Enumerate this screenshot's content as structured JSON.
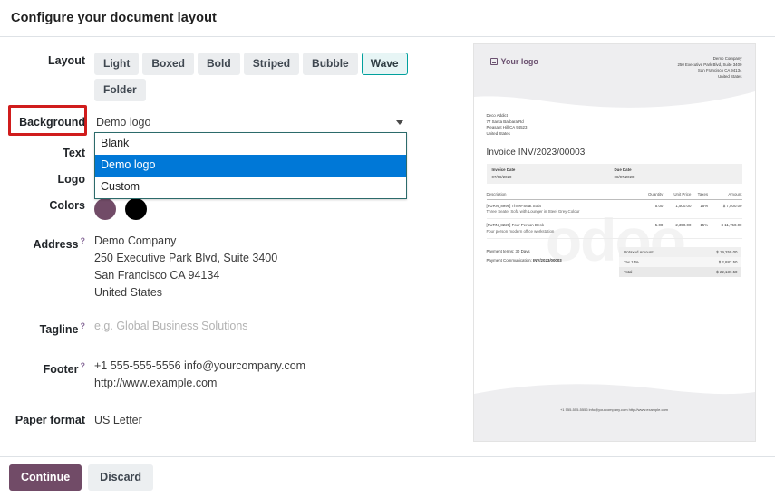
{
  "dialog": {
    "title": "Configure your document layout",
    "continue_label": "Continue",
    "discard_label": "Discard"
  },
  "form": {
    "layout": {
      "label": "Layout",
      "options": [
        "Light",
        "Boxed",
        "Bold",
        "Striped",
        "Bubble",
        "Wave",
        "Folder"
      ],
      "selected": "Wave"
    },
    "background": {
      "label": "Background",
      "value": "Demo logo",
      "open": true,
      "options": [
        "Blank",
        "Demo logo",
        "Custom"
      ],
      "selected": "Demo logo"
    },
    "text": {
      "label": "Text",
      "value": ""
    },
    "logo": {
      "label": "Logo",
      "value": ""
    },
    "colors": {
      "label": "Colors",
      "primary": "#714B67",
      "secondary": "#000000"
    },
    "address": {
      "label": "Address",
      "help": "?",
      "lines": [
        "Demo Company",
        "250 Executive Park Blvd, Suite 3400",
        "San Francisco CA 94134",
        "United States"
      ]
    },
    "tagline": {
      "label": "Tagline",
      "help": "?",
      "placeholder": "e.g. Global Business Solutions",
      "value": ""
    },
    "footer": {
      "label": "Footer",
      "help": "?",
      "lines": [
        "+1 555-555-5556 info@yourcompany.com",
        "http://www.example.com"
      ]
    },
    "paper_format": {
      "label": "Paper format",
      "value": "US Letter"
    }
  },
  "preview": {
    "logo_text": "Your logo",
    "logo_icon": "image-icon",
    "watermark": "odoo",
    "company_address": [
      "Demo Company",
      "250 Executive Park Blvd, Suite 3400",
      "San Francisco CA 94134",
      "United States"
    ],
    "customer_address": [
      "Deco Addict",
      "77 Santa Barbara Rd",
      "Pleasant Hill CA 94523",
      "United States"
    ],
    "invoice_title": "Invoice INV/2023/00003",
    "dates": [
      {
        "label": "Invoice Date",
        "value": "07/08/2020"
      },
      {
        "label": "Due Date",
        "value": "08/07/2020"
      }
    ],
    "table": {
      "headers": [
        "Description",
        "Quantity",
        "Unit Price",
        "Taxes",
        "Amount"
      ],
      "rows": [
        {
          "description": "[FURN_8999] Three-Seat Sofa",
          "subdescription": "Three Seater Sofa with Lounger in Steel Grey Colour",
          "quantity": "5.00",
          "unit_price": "1,500.00",
          "taxes": "15%",
          "amount": "$ 7,500.00"
        },
        {
          "description": "[FURN_8220] Four Person Desk",
          "subdescription": "Four person modern office workstation",
          "quantity": "5.00",
          "unit_price": "2,350.00",
          "taxes": "15%",
          "amount": "$ 11,750.00"
        }
      ]
    },
    "payment_terms_label": "Payment terms:",
    "payment_terms_value": "30 Days",
    "payment_comm_label": "Payment Communication:",
    "payment_comm_value": "INV/2023/00003",
    "totals": [
      {
        "label": "Untaxed Amount",
        "value": "$ 19,250.00"
      },
      {
        "label": "Tax 15%",
        "value": "$ 2,887.50"
      },
      {
        "label": "Total",
        "value": "$ 22,137.50"
      }
    ],
    "footer_text": "+1 555-555-5556 info@yourcompany.com http://www.example.com"
  }
}
